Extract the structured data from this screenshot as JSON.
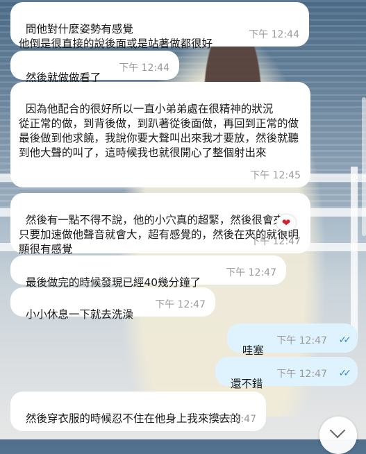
{
  "messages": [
    {
      "dir": "in",
      "text": "問他對什麼姿勢有感覺\n他倒是很直接的說後面或是站著做都很好",
      "time": "下午 12:44"
    },
    {
      "dir": "in",
      "text": "然後就做做看了",
      "time": "下午 12:44"
    },
    {
      "dir": "in",
      "text": "因為他配合的很好所以一直小弟弟處在很精神的狀況\n從正常的做，到背後做，到趴著從後面做，再回到正常的做\n最後做到他求饒，我說你要大聲叫出來我才要放，然後就聽到他大聲的叫了，這時候我也就很開心了整個射出來",
      "time": "下午 12:45"
    },
    {
      "dir": "in",
      "text": "然後有一點不得不說，他的小穴真的超緊，然後很會夾，只要加速做他聲音就會大，超有感覺的，然後在夾的就很明顯很有感覺",
      "time": "下午 12:47"
    },
    {
      "dir": "in",
      "text": "最後做完的時候發現已經40幾分鐘了",
      "time": "下午 12:47"
    },
    {
      "dir": "in",
      "text": "小小休息一下就去洗澡",
      "time": "下午 12:47"
    },
    {
      "dir": "out",
      "text": "哇塞",
      "time": "下午 12:47",
      "read": "✓✓"
    },
    {
      "dir": "out",
      "text": "還不錯",
      "time": "下午 12:47",
      "read": "✓✓"
    },
    {
      "dir": "in",
      "text": "然後穿衣服的時候忍不住在他身上我來摸去的",
      "time": "下午 12:47"
    }
  ],
  "reaction": {
    "icon": "heart-icon",
    "glyph": "❤"
  },
  "scroll_down_icon": "chevron-down-icon",
  "colors": {
    "incoming": "#ffffff",
    "outgoing": "#dff3ff",
    "read_check": "#3a8ad8"
  }
}
